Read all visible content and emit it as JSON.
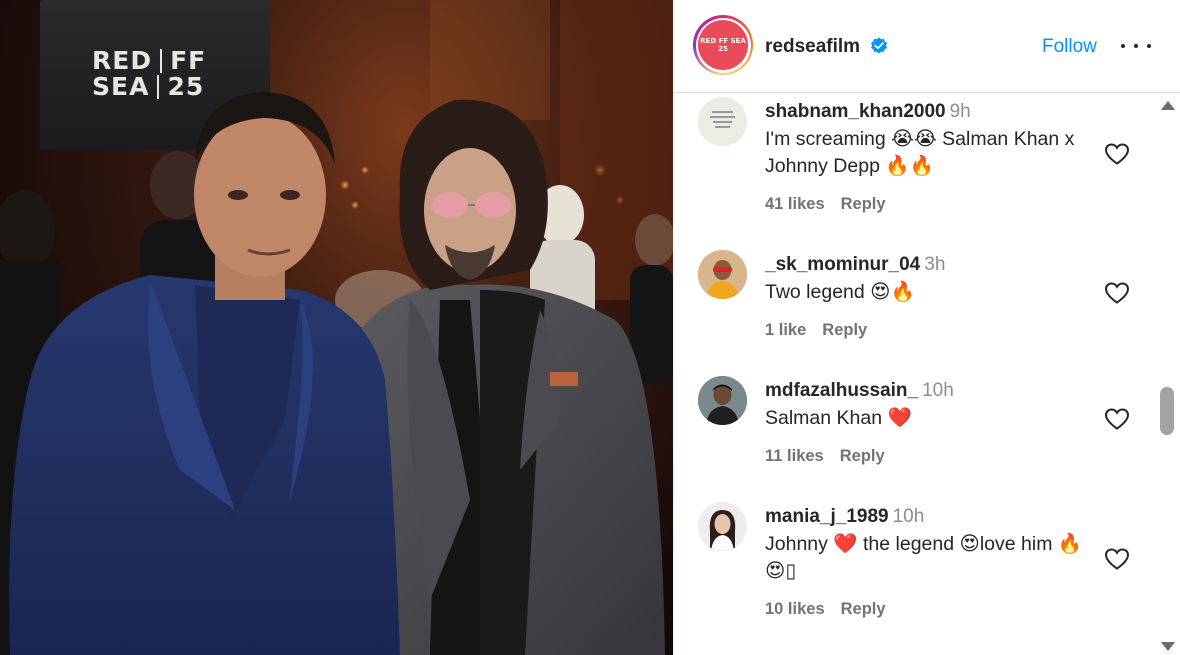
{
  "photo": {
    "screen_logo_line1": "RED",
    "screen_logo_line1b": "FF",
    "screen_logo_line2": "SEA",
    "screen_logo_line2b": "25"
  },
  "post_header": {
    "username": "redseafilm",
    "avatar_text": "RED FF SEA 25",
    "verified_icon": "verified-badge-icon",
    "follow_label": "Follow",
    "more_icon": "more-options-icon",
    "accent_color": "#0095f6"
  },
  "comments": [
    {
      "username": "shabnam_khan2000",
      "time": "9h",
      "text": "I'm screaming 😭😭 Salman Khan x Johnny Depp 🔥🔥",
      "likes": "41 likes",
      "reply": "Reply"
    },
    {
      "username": "_sk_mominur_04",
      "time": "3h",
      "text": "Two legend 😍🔥",
      "likes": "1 like",
      "reply": "Reply"
    },
    {
      "username": "mdfazalhussain_",
      "time": "10h",
      "text": "Salman Khan ❤️",
      "likes": "11 likes",
      "reply": "Reply"
    },
    {
      "username": "mania_j_1989",
      "time": "10h",
      "text": "Johnny ❤️ the legend 😍love him 🔥😍▯",
      "likes": "10 likes",
      "reply": "Reply"
    }
  ]
}
